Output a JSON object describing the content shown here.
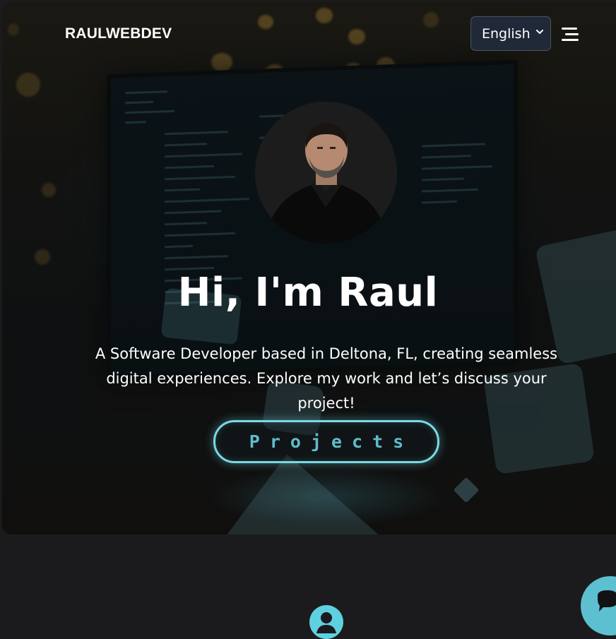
{
  "header": {
    "logo": "RAULWEBDEV",
    "language_select": {
      "selected": "English"
    },
    "menu_icon": "hamburger-icon"
  },
  "hero": {
    "avatar": "profile-photo",
    "heading": "Hi, I'm Raul",
    "tagline": "A Software Developer based in Deltona, FL, creating seamless digital experiences. Explore my work and let’s discuss your project!",
    "cta_label": "Projects"
  },
  "icons": {
    "section_icon": "user-icon",
    "chat_icon": "chat-bubble-icon"
  },
  "colors": {
    "accent": "#5fd0e0",
    "cta_border": "#7ad9e6",
    "cta_text": "#5fbccb",
    "page_background": "#1b1b1d",
    "select_background": "#1f2937"
  }
}
